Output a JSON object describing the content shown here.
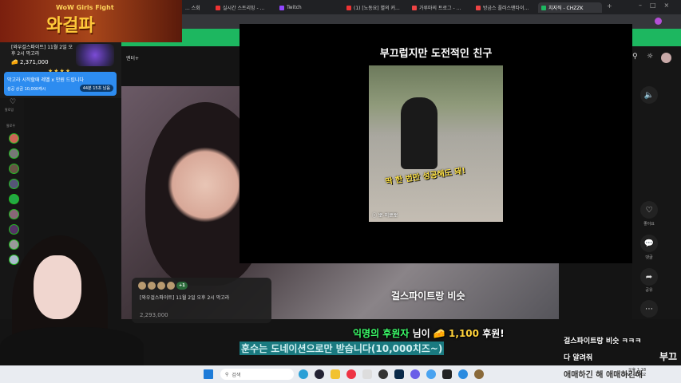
{
  "browser": {
    "tabs": [
      {
        "label": "... 스회"
      },
      {
        "label": "실시간 스트리밍 - ..."
      },
      {
        "label": "Twitch"
      },
      {
        "label": "(1) [노동요] 별의 커..."
      },
      {
        "label": "가루마의 트로그 - ..."
      },
      {
        "label": "방금스 플러스맨타이..."
      },
      {
        "label": "치지직 - CHZZK",
        "active": true
      }
    ]
  },
  "banner": {
    "subtitle": "WoW Girls Fight",
    "title": "와걸파"
  },
  "event_card": {
    "title": "[와우걸스파이트] 11월 2일 오후 2시 막고라",
    "amount": "2,371,000",
    "stars": "★★★★"
  },
  "mission": {
    "text": "막고라 시작할때 레벨 x 만원 드립니다",
    "reward": "성공 상금 10,000캐시",
    "timer": "44분 15초 남음"
  },
  "channel": {
    "label": "엔터+",
    "follow_label": "팔로잉",
    "following_header": "팔로우"
  },
  "popup": {
    "title": "부끄럽지만 도전적인 친구",
    "caption": "딱 한 번만 성공해도 돼!",
    "watermark": "ⓒ 뽀-미뽀뽀"
  },
  "mini_card": {
    "badge": "+1",
    "title": "[와우걸스파이트] 11월 2일 오후 2시 막고라",
    "amount": "2,293,000"
  },
  "overlay": {
    "mid_subtitle": "걸스파이트랑 비슷",
    "donation": {
      "name": "익명의 후원자",
      "suffix": "님이",
      "amount": "1,100",
      "action": "후원!"
    },
    "notice": "훈수는 도네이션으로만 받습니다(10,000치즈~)"
  },
  "right_panel": {
    "like": "좋아요",
    "comment": "댓글",
    "share": "공유"
  },
  "chat": [
    "걸스파이트랑 비슷 ㅋㅋㅋ",
    "다 알려줘",
    "부끄",
    "애매하긴 해 애매하긴해"
  ],
  "taskbar": {
    "search_placeholder": "검색",
    "time": "오후 1:18",
    "date": "2025-11-02"
  }
}
